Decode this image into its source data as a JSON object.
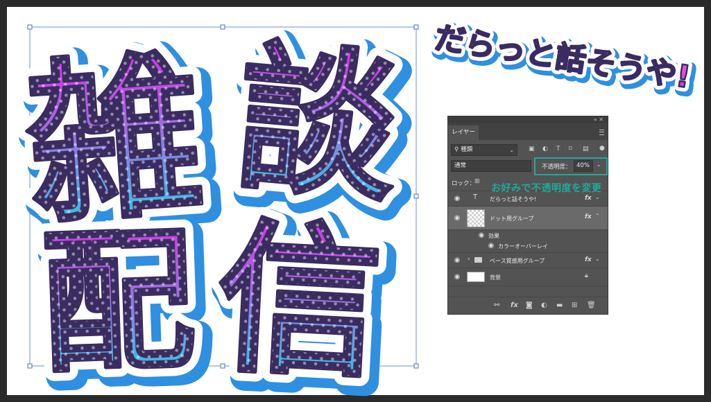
{
  "canvas": {
    "main_title_line1": [
      "雑",
      "談"
    ],
    "main_title_line2": [
      "配",
      "信"
    ],
    "subtitle": "だらっと話そうや!"
  },
  "layers_panel": {
    "tab_label": "レイヤー",
    "filter_value": "種類",
    "blend_mode": "通常",
    "opacity_label": "不透明度：",
    "opacity_value": "40%",
    "lock_label": "ロック：",
    "layers": [
      {
        "name": "だらっと話そうや!",
        "fx": "fx",
        "kind": "text"
      },
      {
        "name": "ドット用グループ",
        "fx": "fx",
        "kind": "smart"
      },
      {
        "name": "効果",
        "kind": "effect-header"
      },
      {
        "name": "カラーオーバーレイ",
        "kind": "effect"
      },
      {
        "name": "ベース質感用グループ",
        "fx": "fx",
        "kind": "group"
      },
      {
        "name": "背景",
        "kind": "background"
      }
    ]
  },
  "annotation": {
    "text": "お好みで不透明度を変更",
    "color": "#23a89b"
  },
  "colors": {
    "gradient_top": "#e22fe6",
    "gradient_mid": "#9b6bdd",
    "gradient_bottom": "#17dbe8",
    "outline_dark": "#3a2c60",
    "shadow_blue": "#2f8fe0",
    "subtitle_fill": "#e44fd6"
  }
}
